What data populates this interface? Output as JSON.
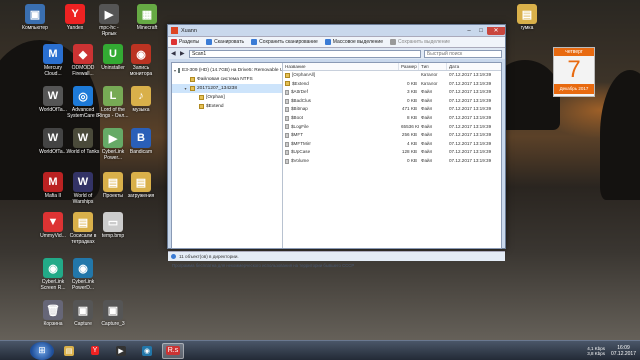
{
  "desktop": {
    "icons": [
      {
        "label": "Компьютер",
        "glyph": "▣",
        "color": "#3a6fb0"
      },
      {
        "label": "Yandex",
        "glyph": "Y",
        "color": "#e22"
      },
      {
        "label": "mpc-hc - Ярлык",
        "glyph": "▶",
        "color": "#555"
      },
      {
        "label": "Minecraft",
        "glyph": "▦",
        "color": "#6a4"
      },
      {
        "label": "Mercury Cloud...",
        "glyph": "M",
        "color": "#2a6fd0"
      },
      {
        "label": "ODMODD Firewall...",
        "glyph": "◆",
        "color": "#c33"
      },
      {
        "label": "Uninstaller",
        "glyph": "U",
        "color": "#3a3"
      },
      {
        "label": "Запись монитора",
        "glyph": "◉",
        "color": "#b32"
      },
      {
        "label": "WorldOfTa...",
        "glyph": "W",
        "color": "#555"
      },
      {
        "label": "Advanced SystemCare 8",
        "glyph": "◎",
        "color": "#1d7ad8"
      },
      {
        "label": "Lord of the Rings - Онл...",
        "glyph": "L",
        "color": "#7a5"
      },
      {
        "label": "музыка",
        "glyph": "♪",
        "color": "#d9b04a"
      },
      {
        "label": "WorldOfTa...",
        "glyph": "W",
        "color": "#444"
      },
      {
        "label": "World of Tanks",
        "glyph": "W",
        "color": "#4a4a3a"
      },
      {
        "label": "CyberLink Power...",
        "glyph": "▶",
        "color": "#6a6"
      },
      {
        "label": "Bandicam",
        "glyph": "B",
        "color": "#2a5fb8"
      },
      {
        "label": "Mafia II",
        "glyph": "M",
        "color": "#b22"
      },
      {
        "label": "World of Warships",
        "glyph": "W",
        "color": "#336"
      },
      {
        "label": "Проекты",
        "glyph": "▤",
        "color": "#d9b04a"
      },
      {
        "label": "загружения",
        "glyph": "▤",
        "color": "#d9b04a"
      },
      {
        "label": "UmmyVid...",
        "glyph": "▼",
        "color": "#d33"
      },
      {
        "label": "Сосисали в тетрадках",
        "glyph": "▤",
        "color": "#d9b04a"
      },
      {
        "label": "temp.bmp",
        "glyph": "▭",
        "color": "#ccc"
      },
      {
        "label": "CyberLink Screen R...",
        "glyph": "◉",
        "color": "#2a8"
      },
      {
        "label": "CyberLink PowerD...",
        "glyph": "◉",
        "color": "#27a"
      },
      {
        "label": "Корзина",
        "glyph": "🗑",
        "color": "#667"
      },
      {
        "label": "Capture",
        "glyph": "▣",
        "color": "#555"
      },
      {
        "label": "Capture_3",
        "glyph": "▣",
        "color": "#555"
      },
      {
        "label": "гумка",
        "glyph": "▤",
        "color": "#d9b04a"
      }
    ],
    "calendar": {
      "dow": "четверг",
      "day": "7",
      "month": "Декабрь 2017"
    }
  },
  "window": {
    "title": "Xuann",
    "toolbar": [
      {
        "label": "Разделы",
        "icon": "partitions-icon",
        "color": "#d33",
        "enabled": true
      },
      {
        "label": "Сканировать",
        "icon": "scan-icon",
        "color": "#3a7bd5",
        "enabled": true
      },
      {
        "label": "Сохранить сканирование",
        "icon": "save-scan-icon",
        "color": "#3a7bd5",
        "enabled": true
      },
      {
        "label": "Массовое выделение",
        "icon": "mass-select-icon",
        "color": "#3a7bd5",
        "enabled": true
      },
      {
        "label": "Сохранить выделение",
        "icon": "save-selection-icon",
        "color": "#999",
        "enabled": false
      }
    ],
    "address": "Scan1",
    "search_placeholder": "Быстрый поиск",
    "tree": [
      {
        "label": "E3-309 (HD) (14.7GB) на Drive5: Removable UF",
        "kind": "drive",
        "indent": 0,
        "selected": false,
        "expand": "▾"
      },
      {
        "label": "Файловая система NTFS",
        "kind": "folder",
        "indent": 1,
        "selected": false,
        "expand": ""
      },
      {
        "label": "20171207_134238",
        "kind": "folder",
        "indent": 1,
        "selected": true,
        "expand": "▾"
      },
      {
        "label": "[Orphan]",
        "kind": "folder",
        "indent": 2,
        "selected": false,
        "expand": ""
      },
      {
        "label": "$Extend",
        "kind": "folder",
        "indent": 2,
        "selected": false,
        "expand": ""
      }
    ],
    "columns": {
      "name": "Название",
      "size": "Размер",
      "type": "Тип",
      "date": "Дата"
    },
    "files": [
      {
        "name": "[OrphanAll]",
        "size": "",
        "type": "Каталог",
        "date": "07.12.2017 13:19:39",
        "folder": true
      },
      {
        "name": "$Extend",
        "size": "0 KB",
        "type": "Каталог",
        "date": "07.12.2017 13:19:39",
        "folder": true
      },
      {
        "name": "$AttrDef",
        "size": "3 KB",
        "type": "Файл",
        "date": "07.12.2017 13:19:39",
        "folder": false
      },
      {
        "name": "$BadClus",
        "size": "0 KB",
        "type": "Файл",
        "date": "07.12.2017 13:19:39",
        "folder": false
      },
      {
        "name": "$Bitmap",
        "size": "471 KB",
        "type": "Файл",
        "date": "07.12.2017 13:19:39",
        "folder": false
      },
      {
        "name": "$Boot",
        "size": "8 KB",
        "type": "Файл",
        "date": "07.12.2017 13:19:39",
        "folder": false
      },
      {
        "name": "$LogFile",
        "size": "65536 KB",
        "type": "Файл",
        "date": "07.12.2017 13:19:39",
        "folder": false
      },
      {
        "name": "$MFT",
        "size": "256 KB",
        "type": "Файл",
        "date": "07.12.2017 13:19:39",
        "folder": false
      },
      {
        "name": "$MFTMirr",
        "size": "4 KB",
        "type": "Файл",
        "date": "07.12.2017 13:19:39",
        "folder": false
      },
      {
        "name": "$UpCase",
        "size": "128 KB",
        "type": "Файл",
        "date": "07.12.2017 13:19:39",
        "folder": false
      },
      {
        "name": "$Volume",
        "size": "0 KB",
        "type": "Файл",
        "date": "07.12.2017 13:19:39",
        "folder": false
      }
    ],
    "status": "11 объект(ов) в директории.",
    "footer": "Программа бесплатна для некоммерческого использования на территории бывшего СССР"
  },
  "taskbar": {
    "apps": [
      {
        "glyph": "▤",
        "color": "#d9b04a",
        "active": false
      },
      {
        "glyph": "Y",
        "color": "#e22",
        "active": false
      },
      {
        "glyph": "▶",
        "color": "#333",
        "active": false
      },
      {
        "glyph": "◉",
        "color": "#27a",
        "active": false
      },
      {
        "glyph": "R.s",
        "color": "#c33",
        "active": true
      }
    ],
    "net_up": "4,1 Kbps",
    "net_down": "3,8 Kbps",
    "time": "16:09",
    "date": "07.12.2017"
  }
}
